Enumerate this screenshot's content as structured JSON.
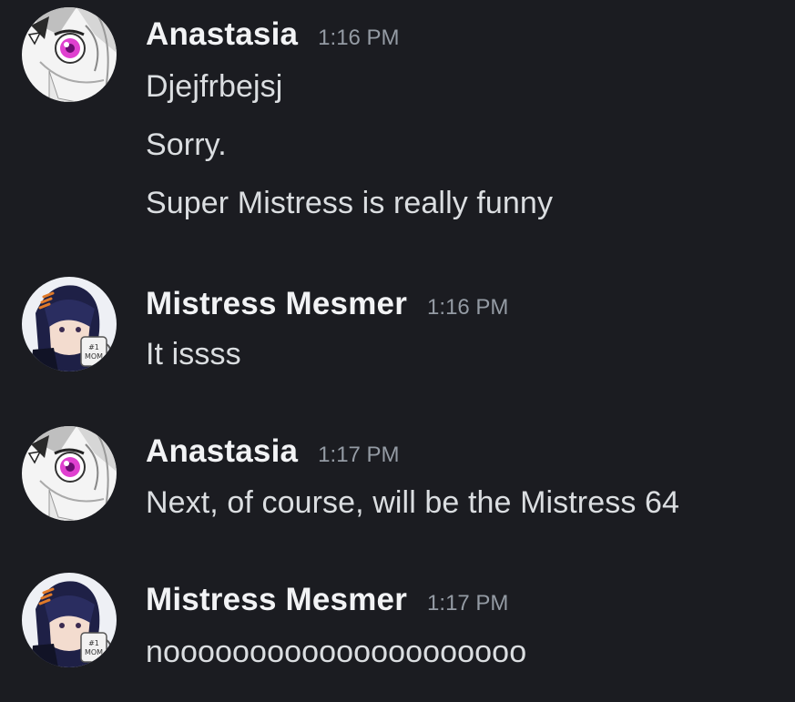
{
  "messages": [
    {
      "author": "Anastasia",
      "avatar_icon": "anime-girl-white-hair-avatar",
      "time": "1:16 PM",
      "lines": [
        "Djejfrbejsj",
        "Sorry.",
        "Super Mistress is really funny"
      ]
    },
    {
      "author": "Mistress Mesmer",
      "avatar_icon": "anime-character-mug-avatar",
      "avatar_mug_text": "#1 MOM",
      "time": "1:16 PM",
      "lines": [
        "It issss"
      ]
    },
    {
      "author": "Anastasia",
      "avatar_icon": "anime-girl-white-hair-avatar",
      "time": "1:17 PM",
      "lines": [
        "Next, of course, will be the Mistress 64"
      ]
    },
    {
      "author": "Mistress Mesmer",
      "avatar_icon": "anime-character-mug-avatar",
      "avatar_mug_text": "#1 MOM",
      "time": "1:17 PM",
      "lines": [
        "nooooooooooooooooooooo"
      ]
    }
  ],
  "colors": {
    "background": "#1b1c21",
    "username": "#f2f3f5",
    "message_text": "#dbdee1",
    "timestamp": "#949ba4",
    "anastasia_eye": "#e040d0",
    "mesmer_accent": "#e07a2a"
  }
}
